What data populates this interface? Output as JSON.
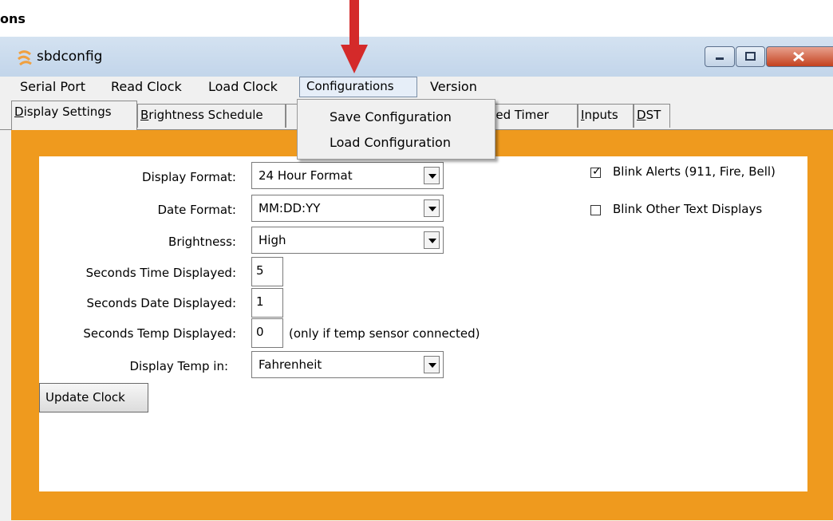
{
  "heading": "ons",
  "window": {
    "title": "sbdconfig"
  },
  "menu": [
    "Serial Port",
    "Read Clock",
    "Load Clock",
    "Configurations",
    "Version"
  ],
  "dropdown": {
    "save": "Save Configuration",
    "load": "Load Configuration"
  },
  "tabs": [
    {
      "pre": "",
      "ul": "D",
      "post": "isplay Settings"
    },
    {
      "pre": "",
      "ul": "B",
      "post": "rightness Schedule"
    },
    {
      "pre": "",
      "ul": "",
      "post": ""
    },
    {
      "pre": "",
      "ul": "",
      "post": "psed Timer"
    },
    {
      "pre": "",
      "ul": "I",
      "post": "nputs"
    },
    {
      "pre": "",
      "ul": "D",
      "post": "ST"
    }
  ],
  "form": {
    "display_format": {
      "label": "Display Format:",
      "value": "24 Hour Format"
    },
    "date_format": {
      "label": "Date Format:",
      "value": "MM:DD:YY"
    },
    "brightness": {
      "label": "Brightness:",
      "value": "High"
    },
    "seconds_time": {
      "label": "Seconds Time Displayed:",
      "value": "5"
    },
    "seconds_date": {
      "label": "Seconds Date Displayed:",
      "value": "1"
    },
    "seconds_temp": {
      "label": "Seconds Temp Displayed:",
      "value": "0",
      "note": "(only if temp sensor connected)"
    },
    "temp_unit": {
      "label": "Display Temp in:",
      "value": "Fahrenheit"
    }
  },
  "checkboxes": {
    "blink_alerts": {
      "label": "Blink Alerts (911, Fire, Bell)",
      "checked": true
    },
    "blink_other": {
      "label": "Blink Other Text Displays",
      "checked": false
    }
  },
  "update_button": "Update Clock",
  "colors": {
    "accent_orange": "#ef9a1e",
    "arrow_red": "#d42a2a"
  }
}
